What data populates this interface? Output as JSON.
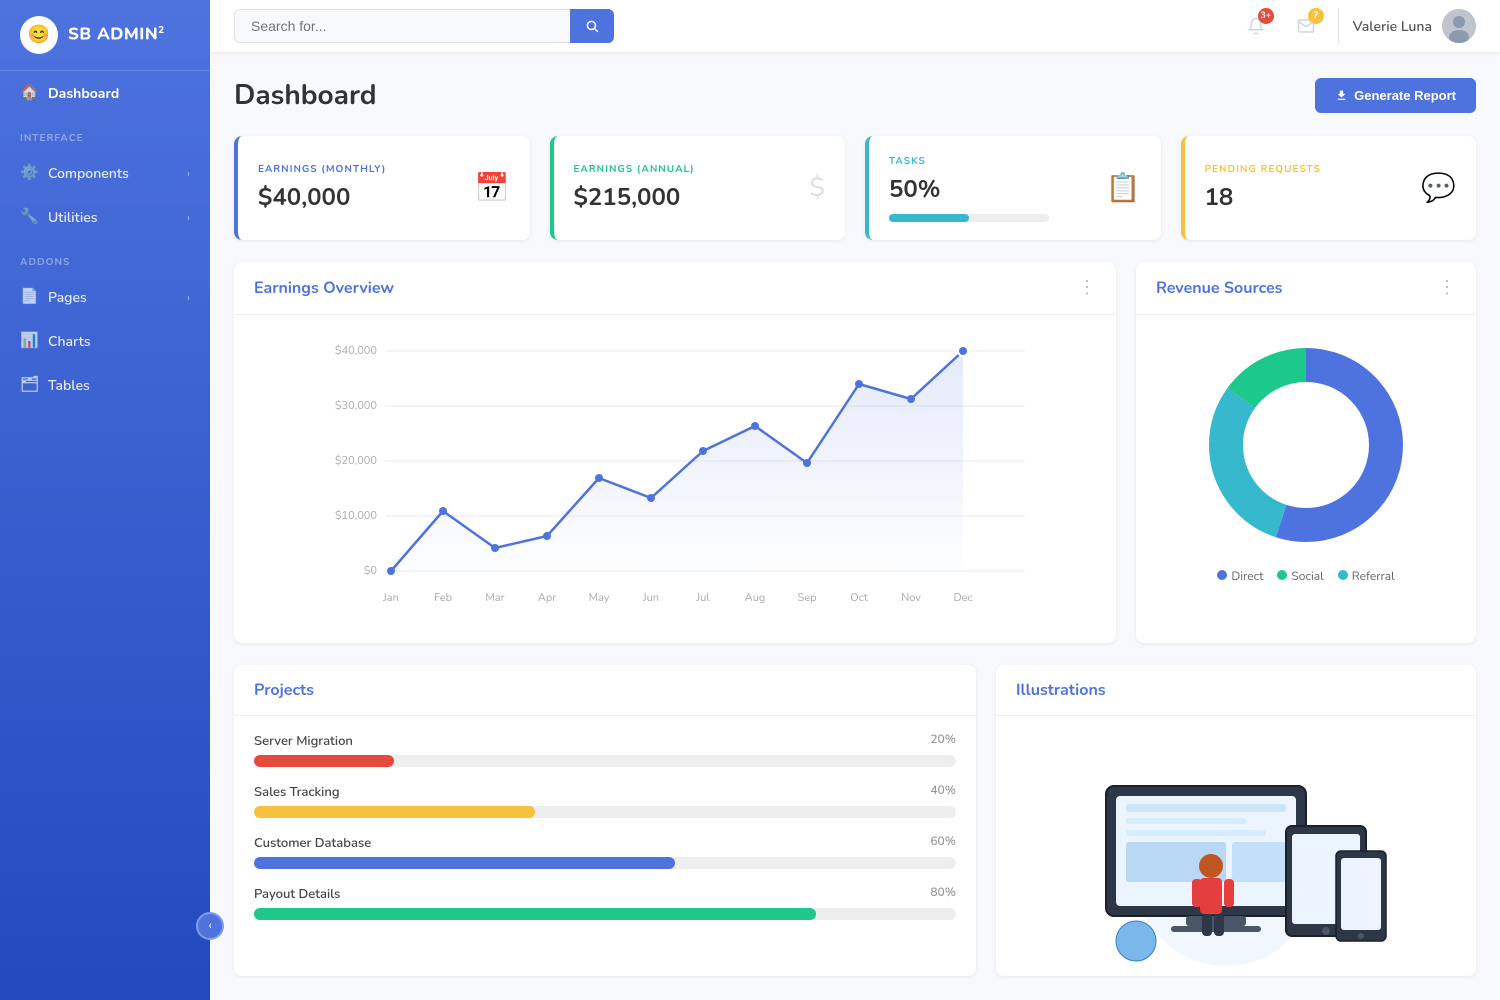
{
  "brand": {
    "name": "SB ADMIN",
    "sup": "2"
  },
  "sidebar": {
    "sections": [
      {
        "label": "INTERFACE",
        "items": [
          {
            "id": "components",
            "label": "Components",
            "icon": "⚙",
            "hasChevron": true,
            "active": false
          },
          {
            "id": "utilities",
            "label": "Utilities",
            "icon": "🔧",
            "hasChevron": true,
            "active": false
          }
        ]
      },
      {
        "label": "ADDONS",
        "items": [
          {
            "id": "pages",
            "label": "Pages",
            "icon": "📄",
            "hasChevron": true,
            "active": false
          },
          {
            "id": "charts",
            "label": "Charts",
            "icon": "📊",
            "hasChevron": false,
            "active": false
          },
          {
            "id": "tables",
            "label": "Tables",
            "icon": "🗂",
            "hasChevron": false,
            "active": false
          }
        ]
      }
    ],
    "dashboard_label": "Dashboard",
    "collapse_btn": "‹"
  },
  "topbar": {
    "search_placeholder": "Search for...",
    "notifications_count": "3+",
    "messages_count": "7",
    "user_name": "Valerie Luna"
  },
  "page": {
    "title": "Dashboard",
    "generate_report": "Generate Report"
  },
  "stat_cards": [
    {
      "label": "EARNINGS (MONTHLY)",
      "value": "$40,000",
      "icon": "📅",
      "type": "blue"
    },
    {
      "label": "EARNINGS (ANNUAL)",
      "value": "$215,000",
      "icon": "$",
      "type": "green"
    },
    {
      "label": "TASKS",
      "value": "50%",
      "progress": 50,
      "icon": "📋",
      "type": "teal"
    },
    {
      "label": "PENDING REQUESTS",
      "value": "18",
      "icon": "💬",
      "type": "yellow"
    }
  ],
  "earnings_chart": {
    "title": "Earnings Overview",
    "months": [
      "Jan",
      "Feb",
      "Mar",
      "Apr",
      "May",
      "Jun",
      "Jul",
      "Aug",
      "Sep",
      "Oct",
      "Nov",
      "Dec"
    ],
    "values": [
      0,
      10000,
      5000,
      7000,
      15000,
      11000,
      20000,
      25000,
      18000,
      30000,
      28000,
      40000
    ],
    "y_labels": [
      "$0",
      "$10,000",
      "$20,000",
      "$30,000",
      "$40,000"
    ]
  },
  "revenue_chart": {
    "title": "Revenue Sources",
    "legend": [
      {
        "label": "Direct",
        "color": "#4e73df"
      },
      {
        "label": "Social",
        "color": "#1cc88a"
      },
      {
        "label": "Referral",
        "color": "#36b9cc"
      }
    ],
    "segments": [
      {
        "pct": 55,
        "color": "#4e73df"
      },
      {
        "pct": 15,
        "color": "#1cc88a"
      },
      {
        "pct": 30,
        "color": "#36b9cc"
      }
    ]
  },
  "projects": {
    "title": "Projects",
    "items": [
      {
        "label": "Server Migration",
        "pct": 20,
        "color": "red"
      },
      {
        "label": "Sales Tracking",
        "pct": 40,
        "color": "yellow"
      },
      {
        "label": "Customer Database",
        "pct": 60,
        "color": "blue"
      },
      {
        "label": "Payout Details",
        "pct": 80,
        "color": "green"
      }
    ]
  },
  "illustrations": {
    "title": "Illustrations"
  }
}
